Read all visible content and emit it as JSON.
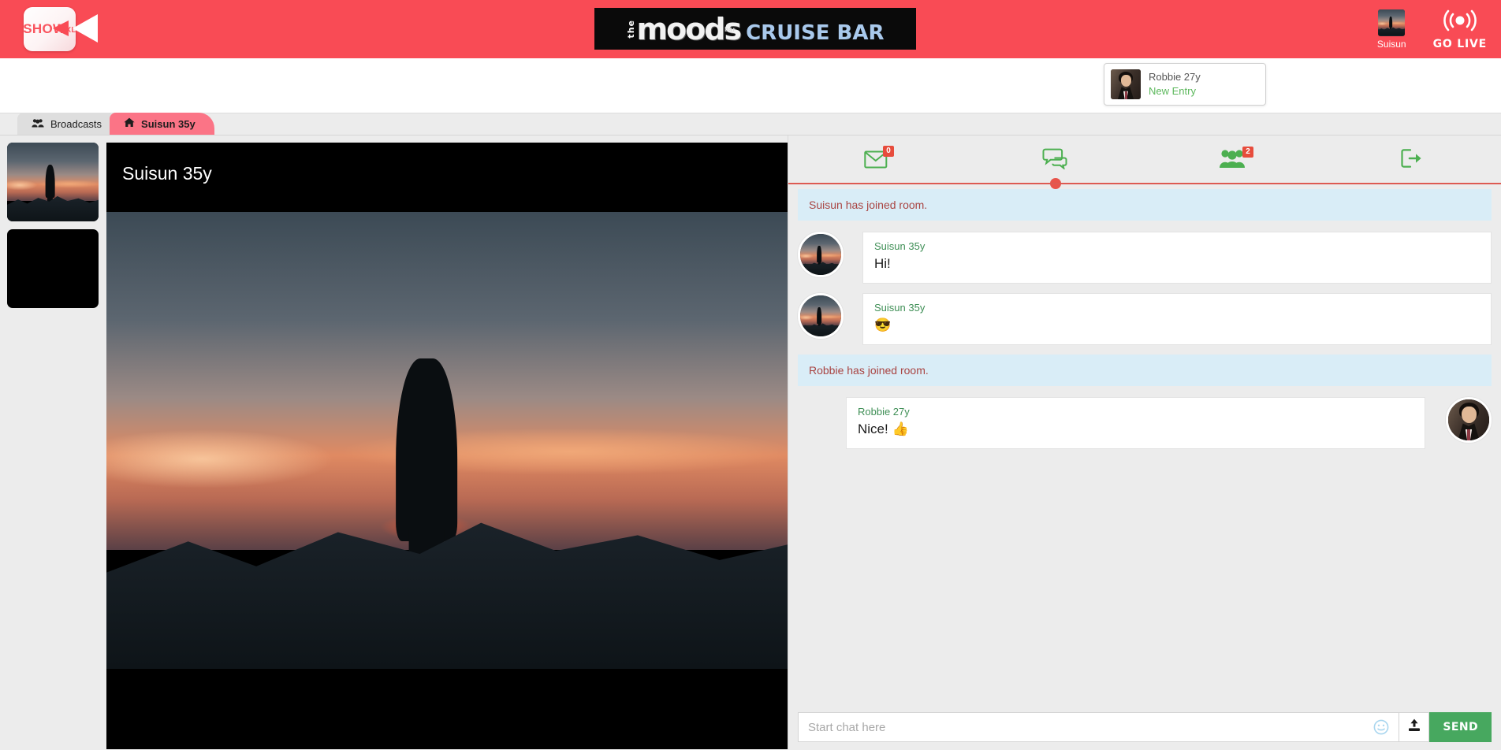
{
  "header": {
    "logo_text": "SHOW",
    "logo_suffix": "XL",
    "logo_icon": "video-camera-icon",
    "banner": {
      "the": "the",
      "moods": "moods",
      "bar": "bar",
      "cruise_bar": "CRUISE BAR"
    },
    "user": {
      "name": "Suisun",
      "avatar_icon": "user-avatar-sunset"
    },
    "go_live": {
      "label": "GO LIVE",
      "icon": "broadcast-icon"
    },
    "accent_color": "#f94b55"
  },
  "notification": {
    "name": "Robbie 27y",
    "status": "New Entry",
    "status_color": "#5cb85c",
    "avatar_icon": "user-avatar-portrait"
  },
  "tabs": [
    {
      "label": "Broadcasts",
      "icon": "users-group-icon",
      "active": false
    },
    {
      "label": "Suisun 35y",
      "icon": "home-icon",
      "active": true
    }
  ],
  "thumbnails": [
    {
      "name": "thumbnail-suisun",
      "kind": "sunset"
    },
    {
      "name": "thumbnail-empty",
      "kind": "black"
    }
  ],
  "stage": {
    "title": "Suisun 35y"
  },
  "chat": {
    "tabs": [
      {
        "name": "messages-tab",
        "icon": "envelope-icon",
        "badge": "0",
        "active": false
      },
      {
        "name": "chat-tab",
        "icon": "chat-bubbles-icon",
        "badge": null,
        "active": true
      },
      {
        "name": "members-tab",
        "icon": "users-group-icon",
        "badge": "2",
        "active": false
      },
      {
        "name": "leave-room-tab",
        "icon": "exit-icon",
        "badge": null,
        "active": false
      }
    ],
    "icon_color": "#4caf50",
    "badge_color": "#e74c3c",
    "messages": [
      {
        "type": "system",
        "text": "Suisun has joined room."
      },
      {
        "type": "message",
        "side": "left",
        "name": "Suisun 35y",
        "text": "Hi!",
        "avatar": "sunset"
      },
      {
        "type": "message",
        "side": "left",
        "name": "Suisun 35y",
        "text": "😎",
        "avatar": "sunset"
      },
      {
        "type": "system",
        "text": "Robbie has joined room."
      },
      {
        "type": "message",
        "side": "right",
        "name": "Robbie 27y",
        "text": "Nice! 👍",
        "avatar": "portrait"
      }
    ],
    "composer": {
      "placeholder": "Start chat here",
      "value": "",
      "emoji_icon": "smiley-icon",
      "upload_icon": "upload-icon",
      "send_label": "SEND",
      "send_color": "#47a85f"
    }
  }
}
